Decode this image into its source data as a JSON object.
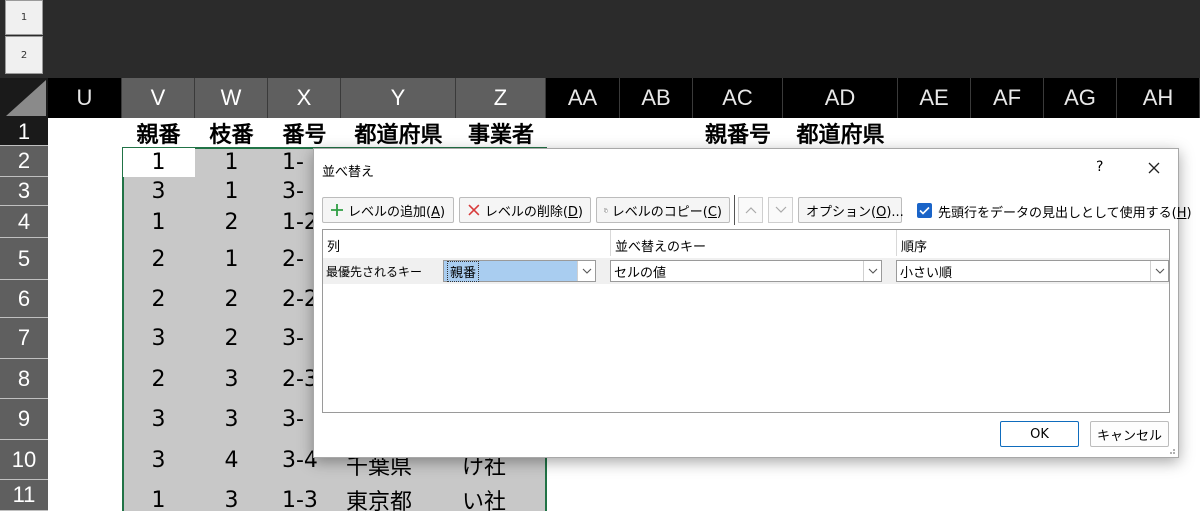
{
  "outline": {
    "levels": [
      "1",
      "2"
    ]
  },
  "columns": [
    "U",
    "V",
    "W",
    "X",
    "Y",
    "Z",
    "AA",
    "AB",
    "AC",
    "AD",
    "AE",
    "AF",
    "AG",
    "AH"
  ],
  "rows": [
    "1",
    "2",
    "3",
    "4",
    "5",
    "6",
    "7",
    "8",
    "9",
    "10",
    "11"
  ],
  "headers": {
    "V": "親番",
    "W": "枝番",
    "X": "番号",
    "Y": "都道府県",
    "Z": "事業者",
    "AC": "親番号",
    "AD": "都道府県"
  },
  "cells": {
    "V": [
      "1",
      "3",
      "1",
      "2",
      "2",
      "3",
      "2",
      "3",
      "3",
      "1"
    ],
    "W": [
      "1",
      "1",
      "2",
      "1",
      "2",
      "2",
      "3",
      "3",
      "4",
      "3"
    ],
    "X": [
      "1-",
      "3-",
      "1-2",
      "2-",
      "2-2",
      "3-",
      "2-3",
      "3-",
      "3-4",
      "1-3"
    ],
    "Y10": "千葉県",
    "Z10": "け社",
    "Y11": "東京都",
    "Z11": "い社"
  },
  "dialog": {
    "title": "並べ替え",
    "help": "?",
    "buttons": {
      "add_level": "レベルの追加(",
      "add_level_key": "A",
      "delete_level": "レベルの削除(",
      "delete_level_key": "D",
      "copy_level": "レベルのコピー(",
      "copy_level_key": "C",
      "options": "オプション(",
      "options_key": "O",
      "options_tail": ")...",
      "close_paren": ")"
    },
    "header_checkbox": {
      "label": "先頭行をデータの見出しとして使用する(",
      "key": "H",
      "tail": ")",
      "checked": true
    },
    "grid_headers": {
      "column": "列",
      "sort_on": "並べ替えのキー",
      "order": "順序"
    },
    "level": {
      "label": "最優先されるキー",
      "column_value": "親番",
      "sort_on_value": "セルの値",
      "order_value": "小さい順"
    },
    "ok": "OK",
    "cancel": "キャンセル"
  },
  "colors": {
    "selection_border": "#217346",
    "accent": "#1a64c8"
  }
}
